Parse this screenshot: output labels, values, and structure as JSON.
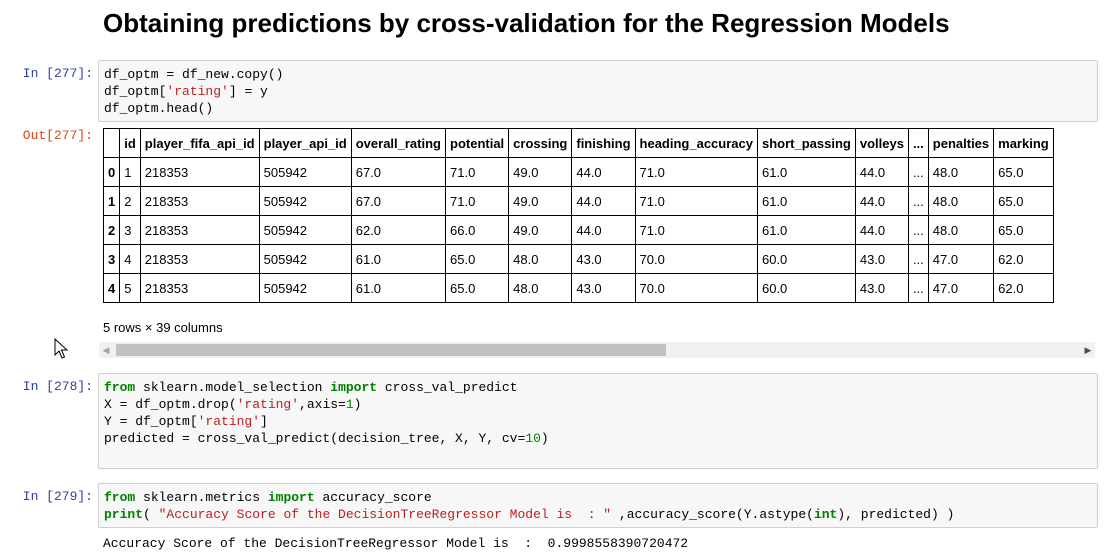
{
  "heading": "Obtaining predictions by cross-validation for the Regression Models",
  "cells": [
    {
      "prompt": "In [277]:",
      "out_prompt": "Out[277]:",
      "code": [
        [
          {
            "t": "df_optm = df_new.copy()",
            "c": ""
          }
        ],
        [
          {
            "t": "df_optm[",
            "c": ""
          },
          {
            "t": "'rating'",
            "c": "str"
          },
          {
            "t": "] = y",
            "c": ""
          }
        ],
        [
          {
            "t": "df_optm.head()",
            "c": ""
          }
        ]
      ]
    },
    {
      "prompt": "In [278]:",
      "code": [
        [
          {
            "t": "from",
            "c": "kw"
          },
          {
            "t": " sklearn.model_selection ",
            "c": ""
          },
          {
            "t": "import",
            "c": "kw"
          },
          {
            "t": " cross_val_predict",
            "c": ""
          }
        ],
        [
          {
            "t": "X = df_optm.drop(",
            "c": ""
          },
          {
            "t": "'rating'",
            "c": "str"
          },
          {
            "t": ",axis=",
            "c": ""
          },
          {
            "t": "1",
            "c": "num"
          },
          {
            "t": ")",
            "c": ""
          }
        ],
        [
          {
            "t": "Y = df_optm[",
            "c": ""
          },
          {
            "t": "'rating'",
            "c": "str"
          },
          {
            "t": "]",
            "c": ""
          }
        ],
        [
          {
            "t": "predicted = cross_val_predict(decision_tree, X, Y, cv=",
            "c": ""
          },
          {
            "t": "10",
            "c": "num"
          },
          {
            "t": ")",
            "c": ""
          }
        ],
        [
          {
            "t": "",
            "c": ""
          }
        ]
      ]
    },
    {
      "prompt": "In [279]:",
      "code": [
        [
          {
            "t": "from",
            "c": "kw"
          },
          {
            "t": " sklearn.metrics ",
            "c": ""
          },
          {
            "t": "import",
            "c": "kw"
          },
          {
            "t": " accuracy_score",
            "c": ""
          }
        ],
        [
          {
            "t": "print",
            "c": "kw"
          },
          {
            "t": "( ",
            "c": ""
          },
          {
            "t": "\"Accuracy Score of the DecisionTreeRegressor Model is  : \"",
            "c": "str"
          },
          {
            "t": " ,accuracy_score(Y.astype(",
            "c": ""
          },
          {
            "t": "int",
            "c": "kw"
          },
          {
            "t": "), predicted) )",
            "c": ""
          }
        ]
      ],
      "stream_output": "Accuracy Score of the DecisionTreeRegressor Model is  :  0.9998558390720472"
    }
  ],
  "dataframe": {
    "columns": [
      "",
      "id",
      "player_fifa_api_id",
      "player_api_id",
      "overall_rating",
      "potential",
      "crossing",
      "finishing",
      "heading_accuracy",
      "short_passing",
      "volleys",
      "...",
      "penalties",
      "marking"
    ],
    "rows": [
      [
        "0",
        "1",
        "218353",
        "505942",
        "67.0",
        "71.0",
        "49.0",
        "44.0",
        "71.0",
        "61.0",
        "44.0",
        "...",
        "48.0",
        "65.0"
      ],
      [
        "1",
        "2",
        "218353",
        "505942",
        "67.0",
        "71.0",
        "49.0",
        "44.0",
        "71.0",
        "61.0",
        "44.0",
        "...",
        "48.0",
        "65.0"
      ],
      [
        "2",
        "3",
        "218353",
        "505942",
        "62.0",
        "66.0",
        "49.0",
        "44.0",
        "71.0",
        "61.0",
        "44.0",
        "...",
        "48.0",
        "65.0"
      ],
      [
        "3",
        "4",
        "218353",
        "505942",
        "61.0",
        "65.0",
        "48.0",
        "43.0",
        "70.0",
        "60.0",
        "43.0",
        "...",
        "47.0",
        "62.0"
      ],
      [
        "4",
        "5",
        "218353",
        "505942",
        "61.0",
        "65.0",
        "48.0",
        "43.0",
        "70.0",
        "60.0",
        "43.0",
        "...",
        "47.0",
        "62.0"
      ]
    ],
    "shape_text": "5 rows × 39 columns"
  },
  "icons": {
    "scroll_left": "scroll-left-arrow-icon",
    "scroll_right": "scroll-right-arrow-icon",
    "cursor": "mouse-pointer-icon"
  },
  "colors": {
    "in_prompt": "#303f9f",
    "out_prompt": "#d84315",
    "keyword": "#008000",
    "string": "#ba2121"
  }
}
